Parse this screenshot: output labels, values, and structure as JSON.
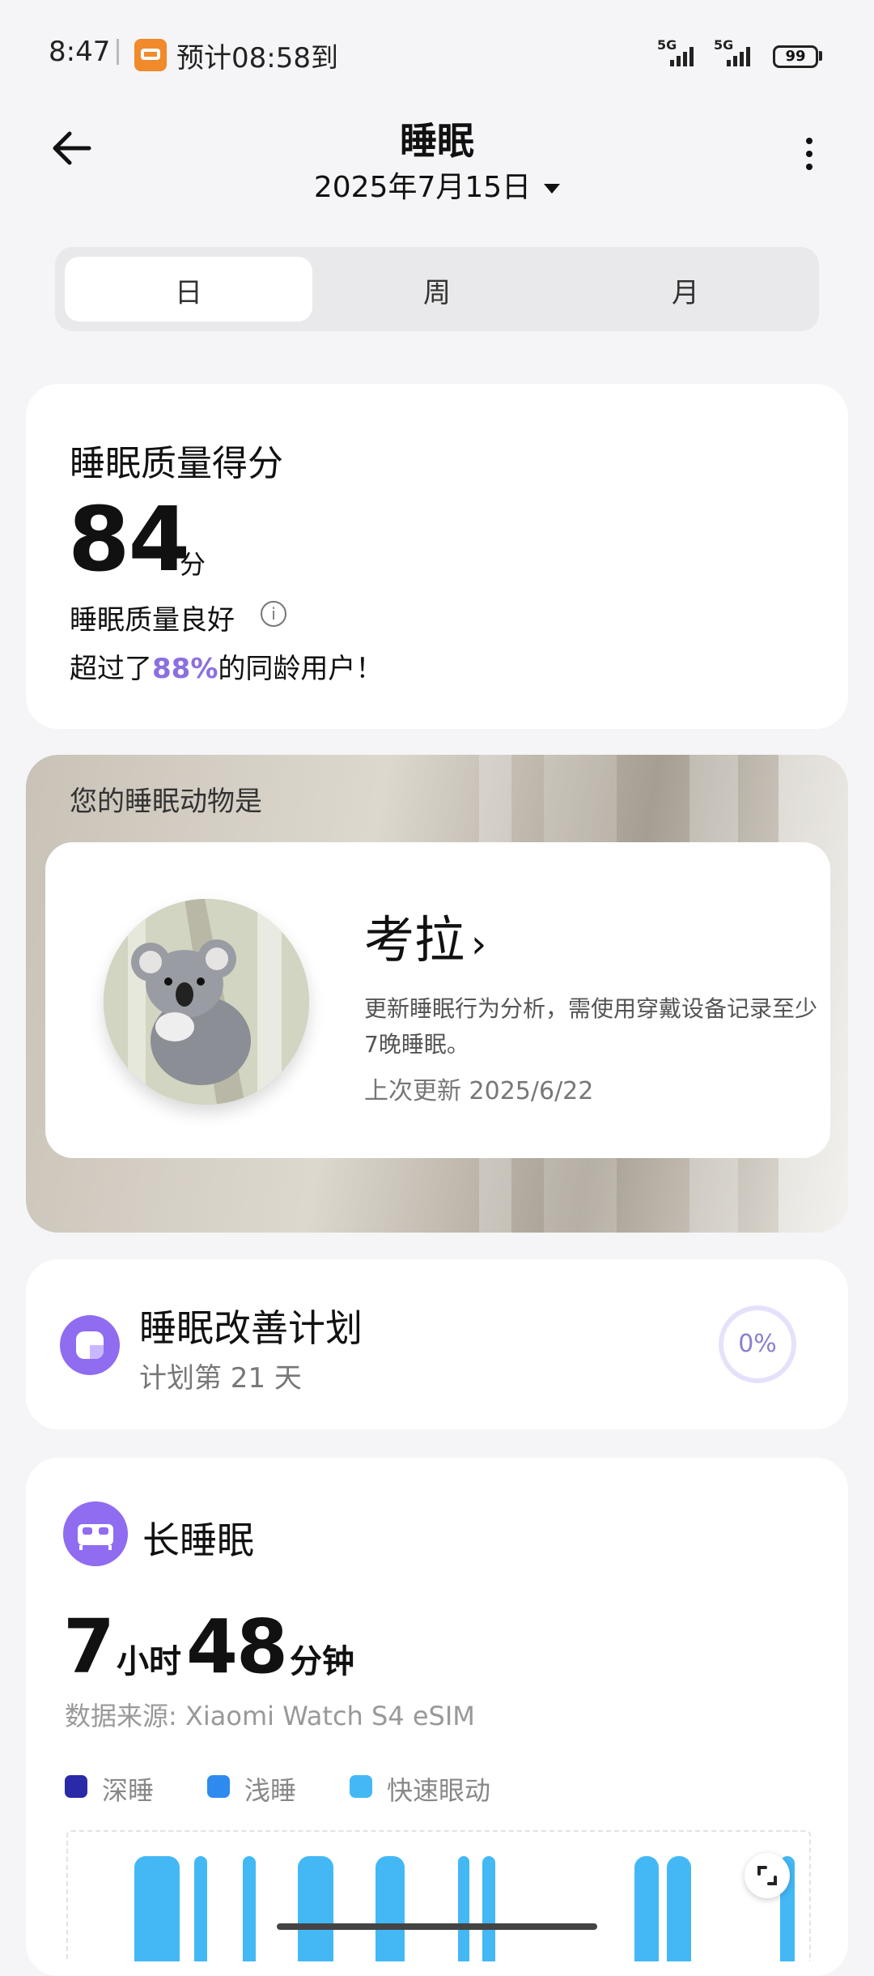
{
  "status_bar": {
    "time": "8:47",
    "eta_text": "预计08:58到",
    "network1": "5G",
    "network2": "5G",
    "battery": "99"
  },
  "header": {
    "title": "睡眠",
    "date": "2025年7月15日"
  },
  "tabs": [
    "日",
    "周",
    "月"
  ],
  "selected_tab": "日",
  "score_card": {
    "heading": "睡眠质量得分",
    "score": "84",
    "unit": "分",
    "quality": "睡眠质量良好",
    "beat_prefix": "超过了",
    "beat_percent": "88%",
    "beat_suffix": "的同龄用户！"
  },
  "animal_card": {
    "heading": "您的睡眠动物是",
    "animal": "考拉",
    "chevron": "›",
    "desc": "更新睡眠行为分析，需使用穿戴设备记录至少7晚睡眠。",
    "updated": "上次更新 2025/6/22"
  },
  "plan_card": {
    "title": "睡眠改善计划",
    "subtitle": "计划第 21 天",
    "progress_text": "0%",
    "progress": 0
  },
  "long_sleep": {
    "title": "长睡眠",
    "hours": "7",
    "hours_unit": "小时",
    "minutes": "48",
    "minutes_unit": "分钟",
    "source": "数据来源: Xiaomi Watch S4 eSIM",
    "legend": [
      {
        "label": "深睡",
        "color": "#2a2aa8"
      },
      {
        "label": "浅睡",
        "color": "#2f8af0"
      },
      {
        "label": "快速眼动",
        "color": "#43b8f5"
      }
    ]
  },
  "colors": {
    "accent": "#8f6cf0",
    "highlight": "#8b6fe0",
    "rem": "#43b8f5"
  }
}
